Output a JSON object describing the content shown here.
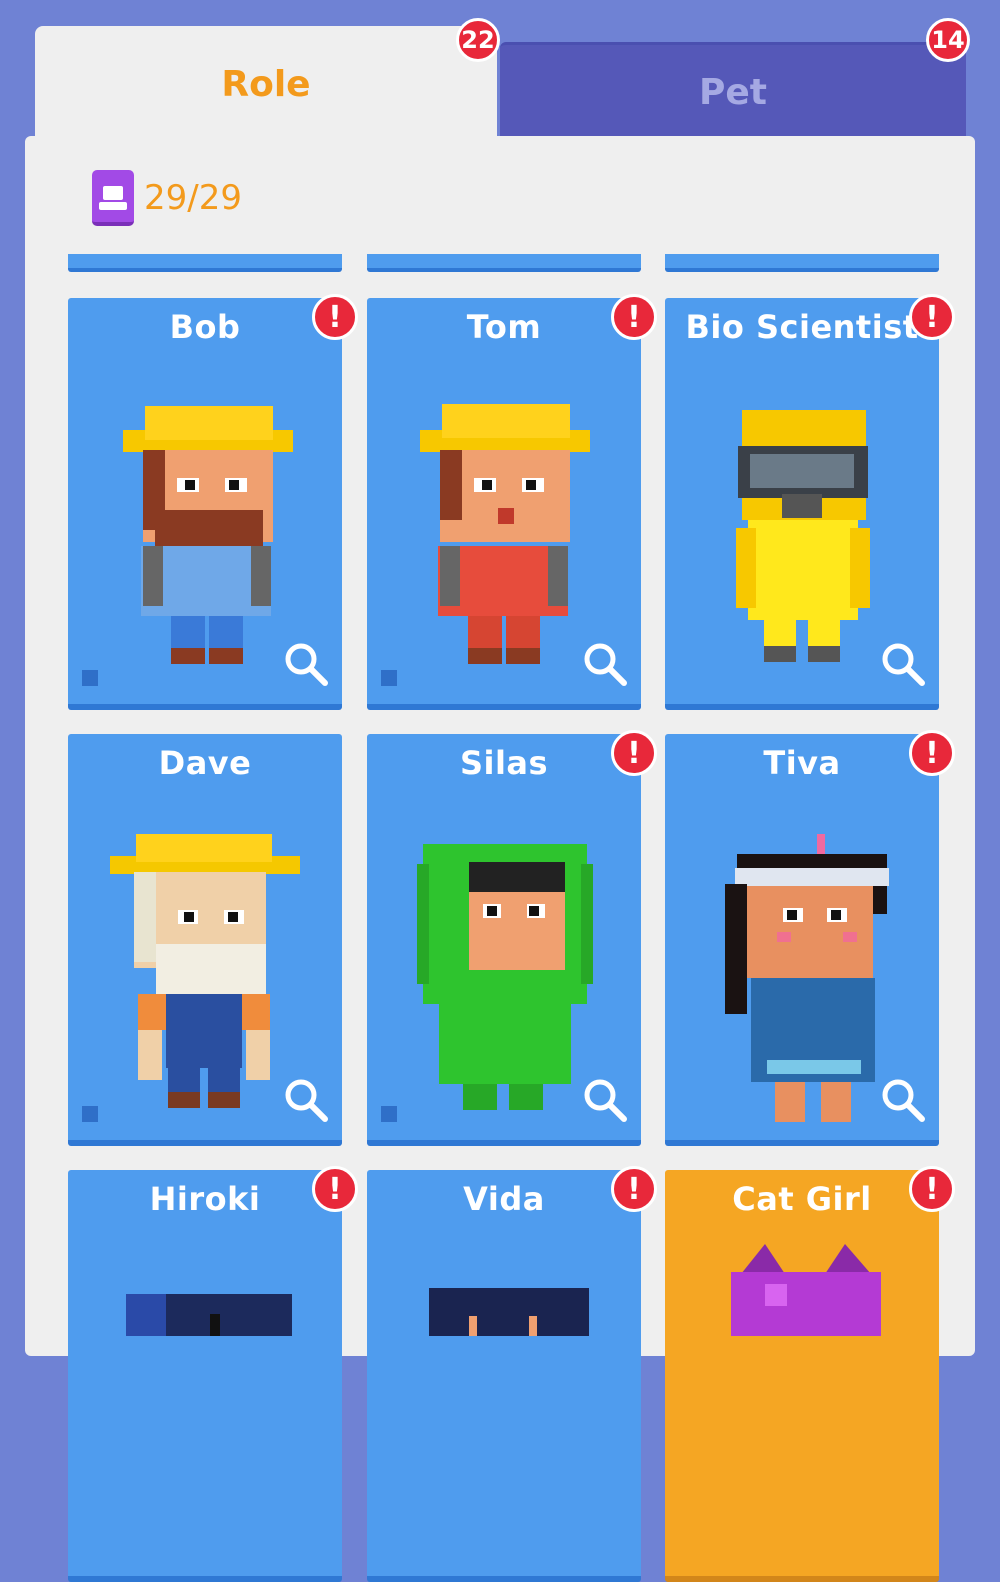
{
  "tabs": [
    {
      "label": "Role",
      "badge": "22",
      "active": true
    },
    {
      "label": "Pet",
      "badge": "14",
      "active": false
    }
  ],
  "collection": {
    "count": "29/29"
  },
  "cards": [
    {
      "name": "Bob",
      "alert": "!"
    },
    {
      "name": "Tom",
      "alert": "!"
    },
    {
      "name": "Bio Scientist",
      "alert": "!"
    },
    {
      "name": "Dave"
    },
    {
      "name": "Silas",
      "alert": "!"
    },
    {
      "name": "Tiva",
      "alert": "!"
    },
    {
      "name": "Hiroki",
      "alert": "!"
    },
    {
      "name": "Vida",
      "alert": "!"
    },
    {
      "name": "Cat Girl",
      "alert": "!"
    }
  ],
  "colors": {
    "card_blue": "#4f9cee",
    "card_gold": "#f5a623",
    "accent": "#f39a1c",
    "alert": "#e8283a"
  }
}
